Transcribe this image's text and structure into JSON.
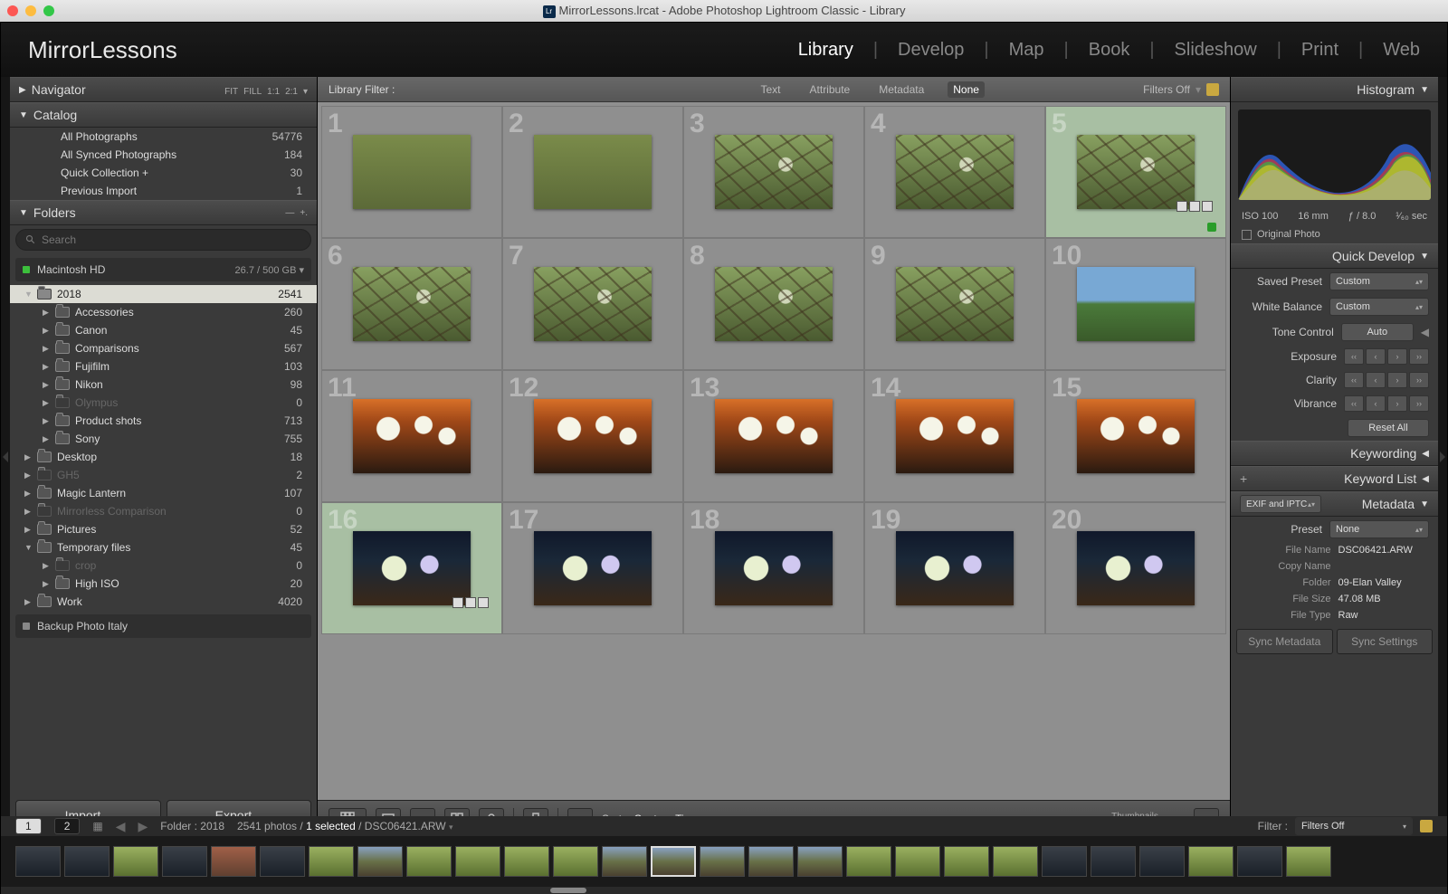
{
  "titlebar": "MirrorLessons.lrcat - Adobe Photoshop Lightroom Classic - Library",
  "brand": "MirrorLessons",
  "modules": [
    "Library",
    "Develop",
    "Map",
    "Book",
    "Slideshow",
    "Print",
    "Web"
  ],
  "activeModule": "Library",
  "navigator": {
    "title": "Navigator",
    "opts": [
      "FIT",
      "FILL",
      "1:1",
      "2:1"
    ]
  },
  "catalog": {
    "title": "Catalog",
    "items": [
      {
        "label": "All Photographs",
        "count": "54776"
      },
      {
        "label": "All Synced Photographs",
        "count": "184"
      },
      {
        "label": "Quick Collection  +",
        "count": "30"
      },
      {
        "label": "Previous Import",
        "count": "1"
      }
    ]
  },
  "folders": {
    "title": "Folders",
    "searchPlaceholder": "Search",
    "volume": {
      "name": "Macintosh HD",
      "space": "26.7 / 500 GB"
    },
    "tree": [
      {
        "label": "2018",
        "count": "2541",
        "ind": 0,
        "open": true,
        "sel": true
      },
      {
        "label": "Accessories",
        "count": "260",
        "ind": 1
      },
      {
        "label": "Canon",
        "count": "45",
        "ind": 1
      },
      {
        "label": "Comparisons",
        "count": "567",
        "ind": 1
      },
      {
        "label": "Fujifilm",
        "count": "103",
        "ind": 1
      },
      {
        "label": "Nikon",
        "count": "98",
        "ind": 1
      },
      {
        "label": "Olympus",
        "count": "0",
        "ind": 1,
        "dim": true
      },
      {
        "label": "Product shots",
        "count": "713",
        "ind": 1
      },
      {
        "label": "Sony",
        "count": "755",
        "ind": 1
      },
      {
        "label": "Desktop",
        "count": "18",
        "ind": 0
      },
      {
        "label": "GH5",
        "count": "2",
        "ind": 0,
        "dim": true
      },
      {
        "label": "Magic Lantern",
        "count": "107",
        "ind": 0
      },
      {
        "label": "Mirrorless Comparison",
        "count": "0",
        "ind": 0,
        "dim": true
      },
      {
        "label": "Pictures",
        "count": "52",
        "ind": 0
      },
      {
        "label": "Temporary files",
        "count": "45",
        "ind": 0,
        "open": true
      },
      {
        "label": "crop",
        "count": "0",
        "ind": 1,
        "dim": true
      },
      {
        "label": "High ISO",
        "count": "20",
        "ind": 1
      },
      {
        "label": "Work",
        "count": "4020",
        "ind": 0
      }
    ],
    "backup": "Backup Photo Italy"
  },
  "buttons": {
    "import": "Import...",
    "export": "Export..."
  },
  "filterbar": {
    "label": "Library Filter :",
    "tabs": [
      "Text",
      "Attribute",
      "Metadata",
      "None"
    ],
    "active": "None",
    "filters": "Filters Off"
  },
  "grid": {
    "cells": [
      {
        "n": 1,
        "t": "tg-grass"
      },
      {
        "n": 2,
        "t": "tg-grass"
      },
      {
        "n": 3,
        "t": "tg-bird"
      },
      {
        "n": 4,
        "t": "tg-bird"
      },
      {
        "n": 5,
        "t": "tg-bird",
        "sel": true,
        "badges": true,
        "flag": true
      },
      {
        "n": 6,
        "t": "tg-bird"
      },
      {
        "n": 7,
        "t": "tg-bird"
      },
      {
        "n": 8,
        "t": "tg-bird"
      },
      {
        "n": 9,
        "t": "tg-bird"
      },
      {
        "n": 10,
        "t": "tg-sky"
      },
      {
        "n": 11,
        "t": "tg-crowd"
      },
      {
        "n": 12,
        "t": "tg-crowd"
      },
      {
        "n": 13,
        "t": "tg-crowd"
      },
      {
        "n": 14,
        "t": "tg-crowd"
      },
      {
        "n": 15,
        "t": "tg-crowd"
      },
      {
        "n": 16,
        "t": "tg-night",
        "sel": true,
        "badges": true
      },
      {
        "n": 17,
        "t": "tg-night"
      },
      {
        "n": 18,
        "t": "tg-night"
      },
      {
        "n": 19,
        "t": "tg-night"
      },
      {
        "n": 20,
        "t": "tg-night"
      }
    ]
  },
  "toolbar": {
    "sortLabel": "Sort:",
    "sortVal": "Capture Time",
    "thumbLabel": "Thumbnails"
  },
  "histogram": {
    "title": "Histogram",
    "info": {
      "iso": "ISO 100",
      "focal": "16 mm",
      "aperture": "ƒ / 8.0",
      "shutter": "¹⁄₆₀ sec"
    },
    "original": "Original Photo"
  },
  "quickdev": {
    "title": "Quick Develop",
    "preset": {
      "label": "Saved Preset",
      "val": "Custom"
    },
    "wb": {
      "label": "White Balance",
      "val": "Custom"
    },
    "tone": {
      "label": "Tone Control",
      "btn": "Auto"
    },
    "sliders": [
      "Exposure",
      "Clarity",
      "Vibrance"
    ],
    "reset": "Reset All"
  },
  "keywording": "Keywording",
  "keywordlist": "Keyword List",
  "metadata": {
    "title": "Metadata",
    "mode": "EXIF and IPTC",
    "preset": {
      "label": "Preset",
      "val": "None"
    },
    "rows": [
      {
        "k": "File Name",
        "v": "DSC06421.ARW"
      },
      {
        "k": "Copy Name",
        "v": ""
      },
      {
        "k": "Folder",
        "v": "09-Elan Valley"
      },
      {
        "k": "File Size",
        "v": "47.08 MB"
      },
      {
        "k": "File Type",
        "v": "Raw"
      }
    ]
  },
  "sync": {
    "meta": "Sync Metadata",
    "settings": "Sync Settings"
  },
  "status": {
    "pills": [
      "1",
      "2"
    ],
    "folder": "Folder : 2018",
    "count": "2541 photos / ",
    "sel": "1 selected ",
    "file": "/ DSC06421.ARW",
    "filterLabel": "Filter :",
    "filterVal": "Filters Off"
  }
}
